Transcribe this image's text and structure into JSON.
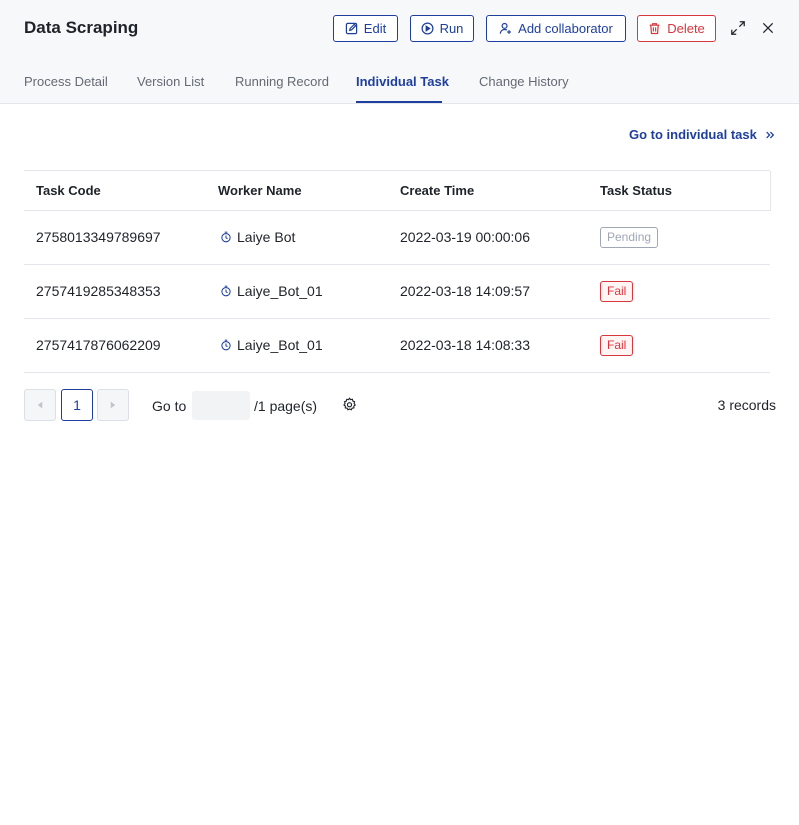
{
  "header": {
    "title": "Data Scraping",
    "buttons": {
      "edit": "Edit",
      "run": "Run",
      "add_collaborator": "Add collaborator",
      "delete": "Delete"
    }
  },
  "tabs": [
    {
      "label": "Process Detail",
      "active": false
    },
    {
      "label": "Version List",
      "active": false
    },
    {
      "label": "Running Record",
      "active": false
    },
    {
      "label": "Individual Task",
      "active": true
    },
    {
      "label": "Change History",
      "active": false
    }
  ],
  "goto_link": {
    "label": "Go to individual task",
    "icon": "double-chevron-right-icon"
  },
  "table": {
    "columns": [
      "Task Code",
      "Worker Name",
      "Create Time",
      "Task Status"
    ],
    "rows": [
      {
        "task_code": "2758013349789697",
        "worker": "Laiye Bot",
        "create_time": "2022-03-19 00:00:06",
        "status": "Pending"
      },
      {
        "task_code": "2757419285348353",
        "worker": "Laiye_Bot_01",
        "create_time": "2022-03-18 14:09:57",
        "status": "Fail"
      },
      {
        "task_code": "2757417876062209",
        "worker": "Laiye_Bot_01",
        "create_time": "2022-03-18 14:08:33",
        "status": "Fail"
      }
    ]
  },
  "pagination": {
    "current_page": "1",
    "goto_label": "Go to",
    "goto_value": "",
    "pages_label": "/1 page(s)",
    "records": "3 records"
  },
  "colors": {
    "accent": "#1f3f9e",
    "danger": "#d9363e",
    "pending": "#a0a7b4"
  }
}
